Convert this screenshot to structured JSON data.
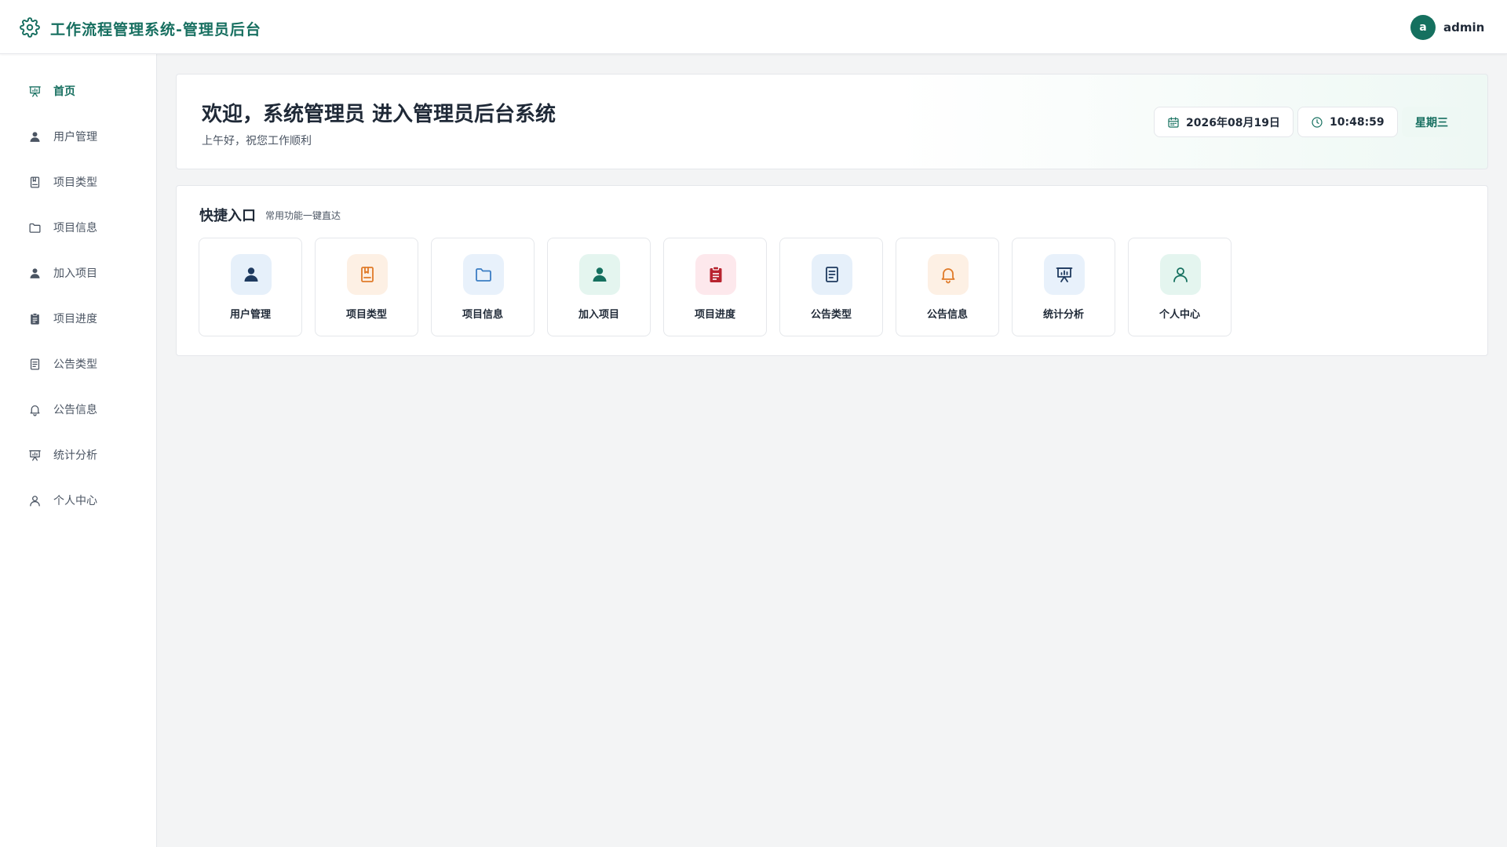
{
  "header": {
    "title": "工作流程管理系统-管理员后台",
    "avatar_letter": "a",
    "username": "admin"
  },
  "sidebar": {
    "items": [
      {
        "label": "首页",
        "icon": "chart-board-icon",
        "active": true
      },
      {
        "label": "用户管理",
        "icon": "user-icon"
      },
      {
        "label": "项目类型",
        "icon": "book-icon"
      },
      {
        "label": "项目信息",
        "icon": "folder-icon"
      },
      {
        "label": "加入项目",
        "icon": "user-icon"
      },
      {
        "label": "项目进度",
        "icon": "clipboard-icon"
      },
      {
        "label": "公告类型",
        "icon": "document-icon"
      },
      {
        "label": "公告信息",
        "icon": "bell-icon"
      },
      {
        "label": "统计分析",
        "icon": "chart-board-icon"
      },
      {
        "label": "个人中心",
        "icon": "user-outline-icon"
      }
    ]
  },
  "welcome": {
    "title": "欢迎，系统管理员 进入管理员后台系统",
    "subtitle": "上午好，祝您工作顺利",
    "date": "2026年08月19日",
    "time": "10:48:59",
    "weekday": "星期三"
  },
  "quick": {
    "title": "快捷入口",
    "subtitle": "常用功能一键直达",
    "cards": [
      {
        "label": "用户管理",
        "icon": "user-icon",
        "bg": "#e6f0fa",
        "color": "#1e3a5f"
      },
      {
        "label": "项目类型",
        "icon": "book-icon",
        "bg": "#fdf0e4",
        "color": "#e07b2a"
      },
      {
        "label": "项目信息",
        "icon": "folder-icon",
        "bg": "#e8f1fb",
        "color": "#3b7dc4"
      },
      {
        "label": "加入项目",
        "icon": "user-icon",
        "bg": "#e4f5ef",
        "color": "#15705f"
      },
      {
        "label": "项目进度",
        "icon": "clipboard-icon",
        "bg": "#fde8ec",
        "color": "#b8232f"
      },
      {
        "label": "公告类型",
        "icon": "document-icon",
        "bg": "#e6f0fa",
        "color": "#1e3a5f"
      },
      {
        "label": "公告信息",
        "icon": "bell-icon",
        "bg": "#fdf0e4",
        "color": "#e07b2a"
      },
      {
        "label": "统计分析",
        "icon": "chart-board-icon",
        "bg": "#e8f1fb",
        "color": "#1e3a5f"
      },
      {
        "label": "个人中心",
        "icon": "user-outline-icon",
        "bg": "#e4f5ef",
        "color": "#15705f"
      }
    ]
  },
  "colors": {
    "accent": "#176f60",
    "sidebar_icon": "#4b5563"
  }
}
